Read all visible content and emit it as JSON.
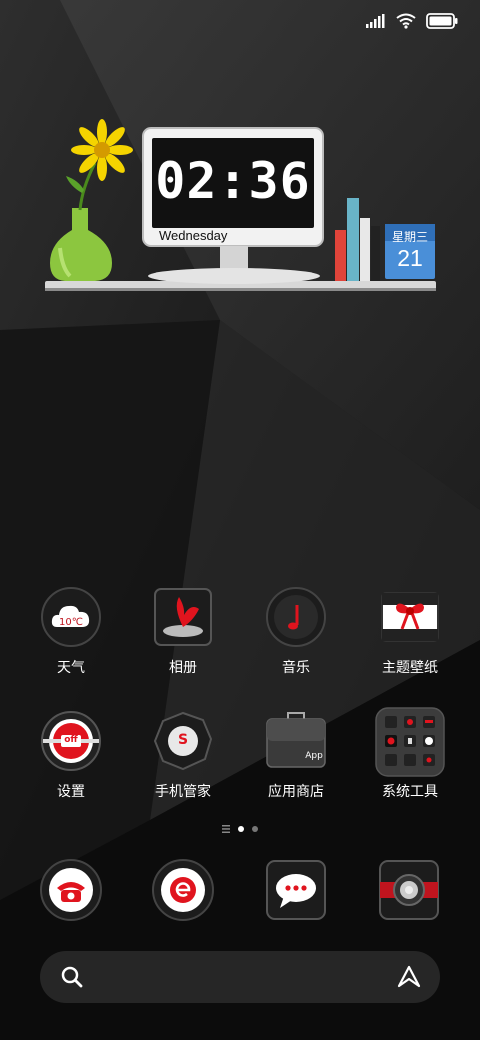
{
  "status_bar": {
    "icons": [
      "signal-icon",
      "wifi-icon",
      "battery-icon"
    ]
  },
  "clock_widget": {
    "time": "02:36",
    "day": "Wednesday"
  },
  "calendar_widget": {
    "weekday": "星期三",
    "date": "21"
  },
  "apps": [
    {
      "label": "天气",
      "icon": "weather-icon",
      "badge": "10℃"
    },
    {
      "label": "相册",
      "icon": "gallery-icon"
    },
    {
      "label": "音乐",
      "icon": "music-icon"
    },
    {
      "label": "主题壁纸",
      "icon": "themes-icon"
    },
    {
      "label": "设置",
      "icon": "settings-icon",
      "badge": "off"
    },
    {
      "label": "手机管家",
      "icon": "security-icon",
      "badge": "S"
    },
    {
      "label": "应用商店",
      "icon": "app-store-icon",
      "badge": "App"
    },
    {
      "label": "系统工具",
      "icon": "tools-folder-icon"
    }
  ],
  "dock": [
    "phone-icon",
    "browser-icon",
    "messages-icon",
    "camera-icon"
  ],
  "page_indicator": {
    "current": 2,
    "total": 2
  },
  "colors": {
    "accent": "#e0141e",
    "calendar_blue": "#4a8fd8",
    "vase_green": "#8cc63f",
    "flower_yellow": "#f5d400"
  }
}
